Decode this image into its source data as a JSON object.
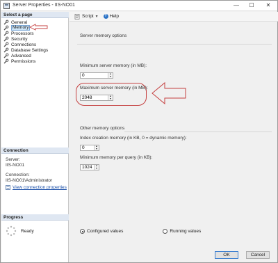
{
  "window": {
    "title": "Server Properties - IIS-NO01",
    "min": "—",
    "max": "☐",
    "close": "✕"
  },
  "select_page": {
    "header": "Select a page",
    "items": [
      {
        "label": "General",
        "selected": false
      },
      {
        "label": "Memory",
        "selected": true
      },
      {
        "label": "Processors",
        "selected": false
      },
      {
        "label": "Security",
        "selected": false
      },
      {
        "label": "Connections",
        "selected": false
      },
      {
        "label": "Database Settings",
        "selected": false
      },
      {
        "label": "Advanced",
        "selected": false
      },
      {
        "label": "Permissions",
        "selected": false
      }
    ]
  },
  "connection": {
    "header": "Connection",
    "server_label": "Server:",
    "server_value": "IIS-NO01",
    "connection_label": "Connection:",
    "connection_value": "IIS-NO01\\Administrator",
    "view_link": "View connection properties"
  },
  "progress": {
    "header": "Progress",
    "status": "Ready"
  },
  "toolbar": {
    "script": "Script",
    "help": "Help",
    "help_glyph": "?"
  },
  "server_memory": {
    "title": "Server memory options",
    "min_label": "Minimum server memory (in MB):",
    "min_value": "0",
    "max_label": "Maximum server memory (in MB):",
    "max_value": "2048"
  },
  "other_memory": {
    "title": "Other memory options",
    "index_label": "Index creation memory (in KB, 0 = dynamic memory):",
    "index_value": "0",
    "query_label": "Minimum memory per query (in KB):",
    "query_value": "1024"
  },
  "values_mode": {
    "configured": "Configured values",
    "running": "Running values",
    "selected": "configured"
  },
  "buttons": {
    "ok": "OK",
    "cancel": "Cancel"
  },
  "colors": {
    "highlight": "#c54040",
    "selection": "#cce4f7",
    "link": "#1a4fa8"
  }
}
